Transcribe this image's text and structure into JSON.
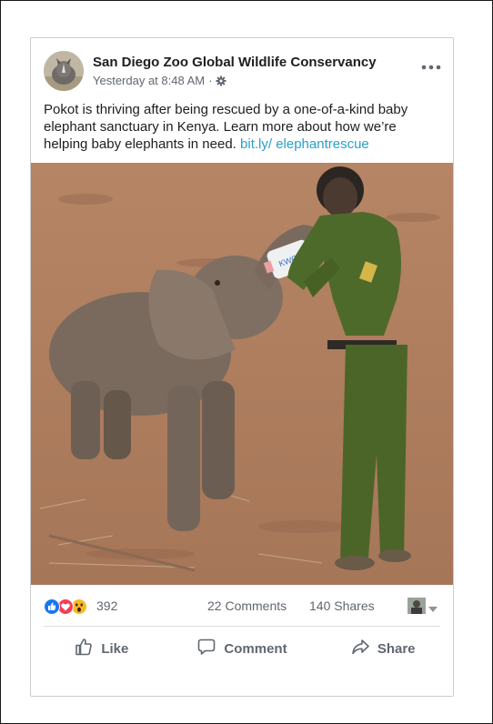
{
  "post": {
    "page_name": "San Diego Zoo Global Wildlife Conservancy",
    "timestamp": "Yesterday at 8:48 AM",
    "separator": "·",
    "text_before_link": "Pokot is thriving after being rescued by a one-of-a-kind baby elephant sanctuary in Kenya. Learn more about how we’re helping baby elephants in need.",
    "link_text": "bit.ly/ elephantrescue",
    "bottle_text": "KWCT"
  },
  "engagement": {
    "reaction_count": "392",
    "comments": "22 Comments",
    "shares": "140 Shares",
    "reactions": [
      "like-icon",
      "love-icon",
      "wow-icon"
    ]
  },
  "actions": {
    "like": "Like",
    "comment": "Comment",
    "share": "Share"
  },
  "colors": {
    "link": "#2a9fc9",
    "like_blue": "#1877f2",
    "love_red": "#f33e58",
    "wow_yellow": "#f7b928",
    "uniform_green": "#4e6a2a"
  }
}
